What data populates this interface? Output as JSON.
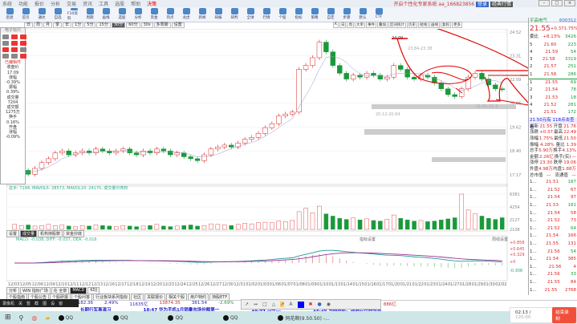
{
  "menu": [
    "系统",
    "功能",
    "报价",
    "分析",
    "交易",
    "资讯",
    "工具",
    "选股",
    "帮助",
    "决策"
  ],
  "window": {
    "title": "西部证券 - a新股软件分析",
    "user": "开启个性化专家系统 aa_166823856",
    "login": "登录",
    "mode": "经典行情"
  },
  "toolbar": [
    "后退",
    "首页",
    "通达",
    "自选",
    "F10资料",
    "周期",
    "画线",
    "选股",
    "分析",
    "资金",
    "热点",
    "龙虎",
    "新闻",
    "研报",
    "研判",
    "全球",
    "行情",
    "个股",
    "指标",
    "策略",
    "自定",
    "步骤",
    "默认",
    "CTF"
  ],
  "periods": [
    "日",
    "周",
    "月",
    "季",
    "年",
    "1分",
    "5分",
    "15分",
    "30分",
    "60分",
    "30s",
    "多周期",
    "设置"
  ],
  "period_active": "30分",
  "chart_toolbar": [
    "K",
    "日",
    "周",
    "大单",
    "事件",
    "叠加",
    "区间统计",
    "历史",
    "短线",
    "画线",
    "复权",
    "更多"
  ],
  "drawpanel": {
    "title": "电子标尺",
    "edit_label": "已编辑件",
    "stats": [
      [
        "收盘价",
        "17.09"
      ],
      [
        "涨幅",
        "-0.39%"
      ],
      [
        "振幅",
        "0.39%"
      ],
      [
        "成交量",
        "7204"
      ],
      [
        "成交额",
        "1275万"
      ],
      [
        "换手",
        "0.16%"
      ],
      [
        "开盘",
        ""
      ],
      [
        "涨幅",
        "-0.09%"
      ]
    ]
  },
  "main_chart": {
    "name": "平高电气",
    "price_axis": [
      "24.52",
      "23.31",
      "22.09",
      "20.86",
      "19.62",
      "18.40",
      "17.17"
    ],
    "high_label": "24.09",
    "zone_labels": [
      "23.84-23.38",
      "20.12-20.64",
      "21.81-21.3"
    ]
  },
  "volume_chart": {
    "legend": "总手: 7194, MAVOL5: 28573, MAVOL10: 24175, 成交量日育权",
    "axis": [
      "6381",
      "4254",
      "2127",
      "2108"
    ]
  },
  "indicator_tabs": [
    "设置",
    "成交量",
    "机构持股数",
    "资金抄底"
  ],
  "macd": {
    "legend": "MACD: -0.038, DIFF: -0.037, DEA: -0.016",
    "axis": [
      "+0.858",
      "+0.645",
      "+0.329",
      "+0",
      "-0.308"
    ],
    "btn": "指标设置",
    "btn2": "周线设置"
  },
  "dates": [
    "12/03",
    "12/05",
    "12/06",
    "12/09",
    "12/10",
    "12/11",
    "12/12",
    "12/13",
    "12/16",
    "12/17",
    "12/18",
    "12/19",
    "12/20",
    "12/23",
    "12/24",
    "12/25",
    "12/26",
    "12/27",
    "12/30",
    "12/31",
    "01/02",
    "01/03",
    "01/06",
    "01/07",
    "01/08",
    "01/09",
    "01/10",
    "01/13",
    "01/14",
    "01/15",
    "01/16",
    "01/17",
    "01/20",
    "01/21",
    "01/22",
    "01/23",
    "01/24",
    "01/27",
    "01/28",
    "01/29",
    "01/30",
    "02/02"
  ],
  "bottom_tabs": [
    "分析",
    "WIN 指标广场",
    "在 全景",
    "MACD",
    "KDJ"
  ],
  "bottom_tabs2": [
    "个股指南",
    "个股公告",
    "个股研报",
    "个股问答",
    "行业板块系列指标",
    "社区",
    "关联报价",
    "相关个股",
    "用户特约",
    "持股ETF"
  ],
  "ticker": [
    "3219.77",
    "182.36",
    "2.49%",
    "11635亿",
    "13874.35",
    "381.54",
    "-2.69%",
    "14212亿",
    "6815亿",
    "1458.50",
    "-58.58",
    "-3.88%",
    "886亿"
  ],
  "news": [
    "长期行军事演习",
    "18:47 华为手机1月销量市场份额第一",
    "18:44 马年...",
    "19:36 电器系统：国通过并购项目"
  ],
  "recorder": {
    "controls": [
      "录像机",
      "关",
      "暂",
      "截",
      "图",
      "设",
      "窗"
    ],
    "time": "02:13",
    "limit": "120:00",
    "stop": "结束录制"
  },
  "taskbar": [
    "QQ",
    "QQ",
    "QQ",
    "QQ",
    "同花顺(9.50.50) -..."
  ],
  "quote": {
    "name": "平高电气",
    "code": "600312",
    "price": "21.55",
    "change": "+0.37",
    "pct": "1.75%",
    "wb_label": "委比",
    "wb": "+8.13%",
    "wc": "3426",
    "sell": [
      [
        "5",
        "21.60",
        "223"
      ],
      [
        "4",
        "21.59",
        "54"
      ],
      [
        "3",
        "21.58",
        "3319"
      ],
      [
        "2",
        "21.57",
        "251"
      ],
      [
        "1",
        "21.56",
        "286"
      ]
    ],
    "buy": [
      [
        "1",
        "21.55",
        "69"
      ],
      [
        "2",
        "21.54",
        "78"
      ],
      [
        "3",
        "21.53",
        "18"
      ],
      [
        "4",
        "21.52",
        "281"
      ],
      [
        "5",
        "21.51",
        "172"
      ]
    ],
    "notice": "21.50元有 118点击查看",
    "stats": [
      [
        "最新",
        "21.55",
        "开盘",
        "21.76"
      ],
      [
        "涨跌",
        "+0.37",
        "最高",
        "22.49"
      ],
      [
        "涨幅",
        "1.75%",
        "最低",
        "21.50"
      ],
      [
        "振幅",
        "4.28%",
        "量比",
        "1.39"
      ],
      [
        "总手",
        "5.90万",
        "换手",
        "4.13%"
      ],
      [
        "金额",
        "2.26亿",
        "换手(实)",
        "—"
      ],
      [
        "涨停",
        "23.30",
        "跌停",
        "19.06"
      ],
      [
        "外盘",
        "4.98万",
        "内盘",
        "1.88万"
      ],
      [
        "总市值",
        "—",
        "流通值",
        "—"
      ]
    ],
    "trades": [
      [
        "1...",
        "21.51",
        "187"
      ],
      [
        "1...",
        "21.52",
        "67"
      ],
      [
        "1...",
        "21.54",
        "97"
      ],
      [
        "1...",
        "21.53",
        "181"
      ],
      [
        "1...",
        "21.54",
        "58"
      ],
      [
        "1...",
        "21.52",
        "73"
      ],
      [
        "1...",
        "21.52",
        "64"
      ],
      [
        "1...",
        "21.54",
        "166"
      ],
      [
        "1...",
        "21.55",
        "131"
      ],
      [
        "1...",
        "21.56",
        "54"
      ],
      [
        "1...",
        "21.54",
        "385"
      ],
      [
        "1...",
        "21.56",
        "4"
      ],
      [
        "1...",
        "21.56",
        "33"
      ],
      [
        "1...",
        "21.55",
        "84"
      ],
      [
        "1...",
        "21.55",
        "2768"
      ]
    ]
  },
  "chart_data": {
    "type": "candlestick",
    "title": "平高电气 30分",
    "ylim": [
      17.17,
      24.52
    ],
    "close": [
      17.3,
      17.4,
      17.2,
      17.5,
      17.8,
      18.0,
      18.3,
      18.4,
      18.2,
      18.3,
      18.4,
      18.3,
      18.5,
      18.4,
      18.3,
      18.4,
      18.5,
      18.3,
      18.2,
      18.4,
      18.3,
      18.5,
      18.4,
      18.2,
      18.3,
      18.1,
      18.0,
      17.9,
      18.2,
      18.5,
      18.6,
      18.7,
      18.6,
      18.8,
      19.0,
      19.1,
      19.3,
      19.6,
      19.8,
      20.2,
      20.3,
      20.4,
      22.6,
      22.8,
      23.2,
      24.0,
      23.5,
      22.8,
      22.4,
      22.1,
      22.3,
      22.2,
      22.4,
      22.3,
      22.1,
      22.2,
      22.8,
      22.6,
      22.2,
      22.1,
      22.3,
      22.2,
      21.9,
      21.6,
      21.3,
      21.2,
      21.6,
      22.2,
      22.4,
      22.1,
      21.8,
      21.6,
      21.55
    ],
    "volume": [
      900,
      700,
      800,
      600,
      700,
      900,
      700,
      800,
      600,
      500,
      700,
      600,
      800,
      700,
      600,
      500,
      700,
      600,
      500,
      600,
      700,
      900,
      600,
      500,
      600,
      700,
      800,
      600,
      700,
      1000,
      900,
      800,
      700,
      900,
      1100,
      1000,
      1200,
      1300,
      1200,
      1500,
      1400,
      1600,
      3200,
      3800,
      3000,
      4200,
      2800,
      2400,
      2000,
      1800,
      2100,
      1700,
      1900,
      1600,
      1500,
      1800,
      2600,
      2000,
      1700,
      1500,
      1600,
      1400,
      1500,
      1700,
      1900,
      2100,
      6381,
      3500,
      2800,
      2400,
      2000,
      1800,
      2108
    ],
    "colors": {
      "up": "#d22",
      "down": "#1a9a3a",
      "annotation": "#e00000"
    }
  }
}
